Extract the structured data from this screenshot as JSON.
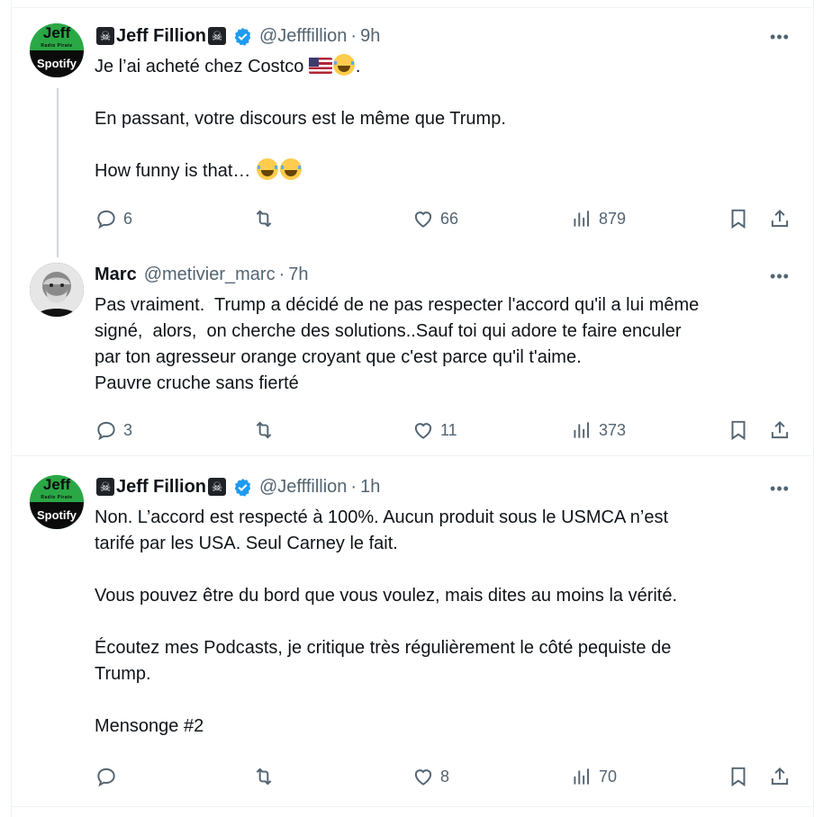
{
  "tweets": [
    {
      "avatar": {
        "line1": "Jeff",
        "line2": "Radio Pirate",
        "line3": "Spotify"
      },
      "name": "Jeff Fillion",
      "handle": "@Jefffillion",
      "dot": "·",
      "time": "9h",
      "text_line1": "Je l’ai acheté chez Costco",
      "text_rest": "En passant, votre discours est le même que Trump.\n\nHow funny is that…",
      "stats": {
        "replies": "6",
        "retweets": "",
        "likes": "66",
        "views": "879"
      }
    },
    {
      "avatar": {
        "line1": "",
        "line2": "",
        "line3": ""
      },
      "name": "Marc",
      "handle": "@metivier_marc",
      "dot": "·",
      "time": "7h",
      "text": "Pas vraiment.  Trump a décidé de ne pas respecter l'accord qu'il a lui même\nsigné,  alors,  on cherche des solutions..Sauf toi qui adore te faire enculer\npar ton agresseur orange croyant que c'est parce qu'il t'aime.\nPauvre cruche sans fierté",
      "stats": {
        "replies": "3",
        "retweets": "",
        "likes": "11",
        "views": "373"
      }
    },
    {
      "avatar": {
        "line1": "Jeff",
        "line2": "Radio Pirate",
        "line3": "Spotify"
      },
      "name": "Jeff Fillion",
      "handle": "@Jefffillion",
      "dot": "·",
      "time": "1h",
      "text": "Non. L’accord est respecté à 100%. Aucun produit sous le USMCA n’est\ntarifé par les USA. Seul Carney le fait.\n\nVous pouvez être du bord que vous voulez, mais dites au moins la vérité.\n\nÉcoutez mes Podcasts, je critique très régulièrement le côté pequiste de\nTrump.\n\nMensonge #2",
      "stats": {
        "replies": "",
        "retweets": "",
        "likes": "8",
        "views": "70"
      }
    }
  ],
  "ui": {
    "more": "•••"
  },
  "icons": [
    "reply-icon",
    "retweet-icon",
    "like-icon",
    "views-icon",
    "bookmark-icon",
    "share-icon",
    "verified-icon",
    "pirate-flag-icon",
    "more-icon"
  ],
  "colors": {
    "text": "#0f1419",
    "muted": "#536471",
    "verified": "#1d9bf0",
    "divider": "#eff3f4"
  }
}
